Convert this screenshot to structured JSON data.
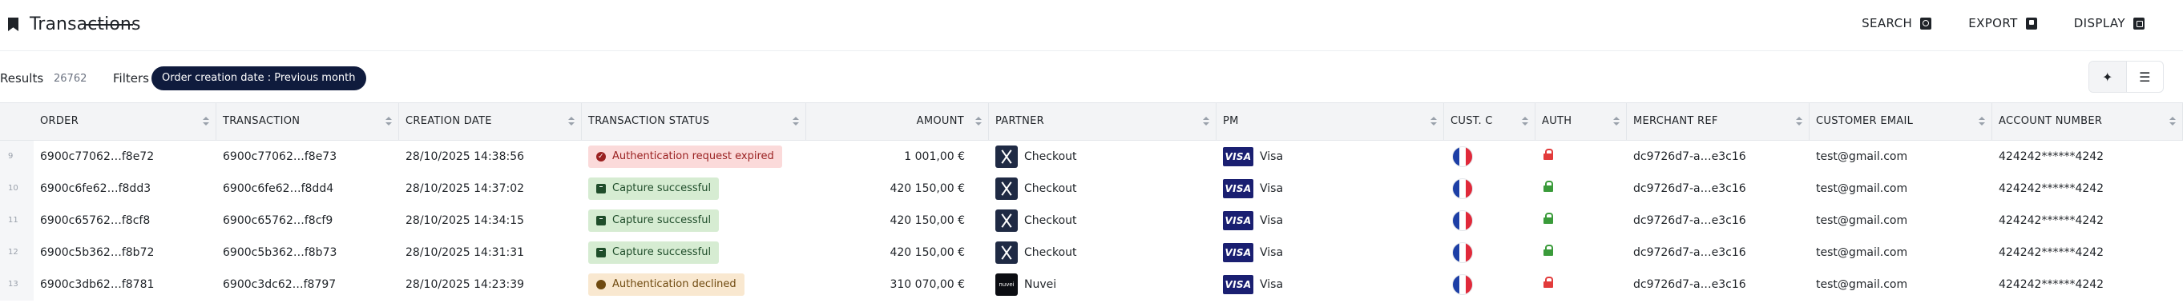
{
  "header": {
    "title": "Transactions",
    "actions": [
      {
        "label": "SEARCH",
        "icon": "search-icon"
      },
      {
        "label": "EXPORT",
        "icon": "export-icon"
      },
      {
        "label": "DISPLAY",
        "icon": "display-icon"
      }
    ]
  },
  "filters": {
    "results_label": "Results",
    "results_count": "26762",
    "filters_label": "Filters",
    "chip": "Order creation date :  Previous month"
  },
  "table": {
    "columns": [
      "ORDER",
      "TRANSACTION",
      "CREATION DATE",
      "TRANSACTION STATUS",
      "AMOUNT",
      "PARTNER",
      "PM",
      "CUST. C",
      "AUTH",
      "MERCHANT REF",
      "CUSTOMER EMAIL",
      "ACCOUNT NUMBER"
    ],
    "rows": [
      {
        "index": "9",
        "order": "6900c77062…f8e72",
        "transaction": "6900c77062…f8e73",
        "date": "28/10/2025 14:38:56",
        "status": "Authentication request expired",
        "status_kind": "danger",
        "amount": "1 001,00 €",
        "partner": "Checkout",
        "partner_logo": "checkout",
        "pm": "Visa",
        "country": "FR",
        "auth": "red",
        "merchant_ref": "dc9726d7-a…e3c16",
        "email": "test@gmail.com",
        "account": "424242******4242"
      },
      {
        "index": "10",
        "order": "6900c6fe62…f8dd3",
        "transaction": "6900c6fe62…f8dd4",
        "date": "28/10/2025 14:37:02",
        "status": "Capture successful",
        "status_kind": "success",
        "amount": "420 150,00 €",
        "partner": "Checkout",
        "partner_logo": "checkout",
        "pm": "Visa",
        "country": "FR",
        "auth": "green",
        "merchant_ref": "dc9726d7-a…e3c16",
        "email": "test@gmail.com",
        "account": "424242******4242"
      },
      {
        "index": "11",
        "order": "6900c65762…f8cf8",
        "transaction": "6900c65762…f8cf9",
        "date": "28/10/2025 14:34:15",
        "status": "Capture successful",
        "status_kind": "success",
        "amount": "420 150,00 €",
        "partner": "Checkout",
        "partner_logo": "checkout",
        "pm": "Visa",
        "country": "FR",
        "auth": "green",
        "merchant_ref": "dc9726d7-a…e3c16",
        "email": "test@gmail.com",
        "account": "424242******4242"
      },
      {
        "index": "12",
        "order": "6900c5b362…f8b72",
        "transaction": "6900c5b362…f8b73",
        "date": "28/10/2025 14:31:31",
        "status": "Capture successful",
        "status_kind": "success",
        "amount": "420 150,00 €",
        "partner": "Checkout",
        "partner_logo": "checkout",
        "pm": "Visa",
        "country": "FR",
        "auth": "green",
        "merchant_ref": "dc9726d7-a…e3c16",
        "email": "test@gmail.com",
        "account": "424242******4242"
      },
      {
        "index": "13",
        "order": "6900c3db62…f8781",
        "transaction": "6900c3dc62…f8797",
        "date": "28/10/2025 14:23:39",
        "status": "Authentication declined",
        "status_kind": "warn",
        "amount": "310 070,00 €",
        "partner": "Nuvei",
        "partner_logo": "nuvei",
        "pm": "Visa",
        "country": "FR",
        "auth": "red",
        "merchant_ref": "dc9726d7-a…e3c16",
        "email": "test@gmail.com",
        "account": "424242******4242"
      }
    ]
  },
  "logos": {
    "visa": "VISA",
    "nuvei": "nuvei"
  },
  "colors": {
    "chip_bg": "#0f1b3d",
    "danger_bg": "#fbdada",
    "success_bg": "#d6ecd2",
    "warn_bg": "#f9e8d0",
    "visa_blue": "#1a1f71"
  }
}
